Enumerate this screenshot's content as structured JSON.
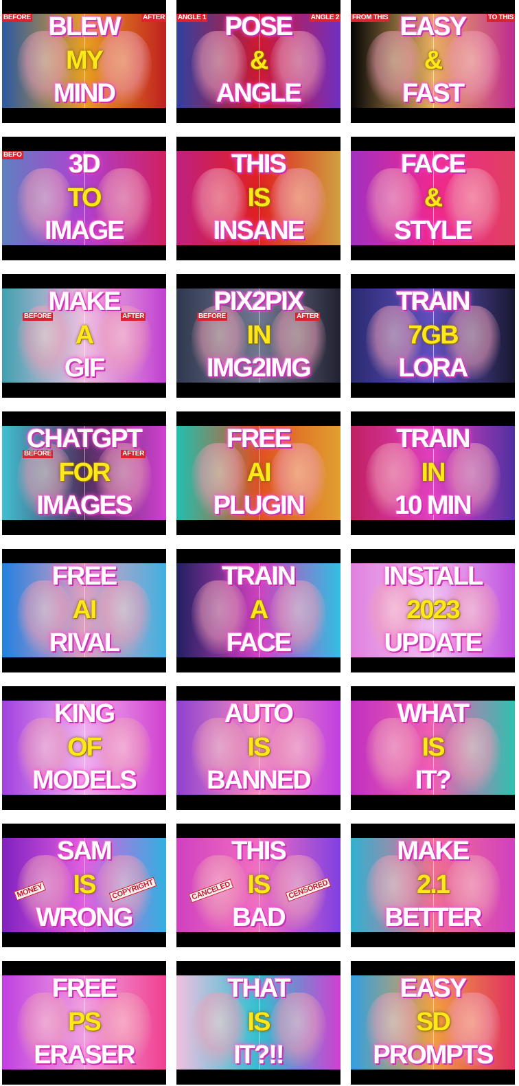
{
  "thumbnails": [
    {
      "lines": [
        "BLEW",
        "MY",
        "MIND"
      ],
      "tags": [
        {
          "text": "BEFORE",
          "side": "left",
          "row": "top"
        },
        {
          "text": "AFTER",
          "side": "right",
          "row": "top"
        }
      ],
      "colors": [
        "#2a5aa0",
        "#e8a020",
        "#c02020"
      ]
    },
    {
      "lines": [
        "POSE",
        "&",
        "ANGLE"
      ],
      "tags": [
        {
          "text": "ANGLE 1",
          "side": "left",
          "row": "top"
        },
        {
          "text": "ANGLE 2",
          "side": "right",
          "row": "top"
        }
      ],
      "colors": [
        "#3040a0",
        "#d01830",
        "#7030c0"
      ]
    },
    {
      "lines": [
        "EASY",
        "&",
        "FAST"
      ],
      "tags": [
        {
          "text": "FROM THIS",
          "side": "left",
          "row": "top"
        },
        {
          "text": "TO THIS",
          "side": "right",
          "row": "top"
        }
      ],
      "colors": [
        "#050505",
        "#e8b060",
        "#c02a90"
      ]
    },
    {
      "lines": [
        "3D",
        "TO",
        "IMAGE"
      ],
      "tags": [
        {
          "text": "BEFO",
          "side": "left",
          "row": "top"
        }
      ],
      "colors": [
        "#6080c0",
        "#b040d0",
        "#d02060"
      ]
    },
    {
      "lines": [
        "THIS",
        "IS",
        "INSANE"
      ],
      "tags": [],
      "colors": [
        "#c02080",
        "#e02020",
        "#d0a040"
      ]
    },
    {
      "lines": [
        "FACE",
        "&",
        "STYLE"
      ],
      "tags": [],
      "colors": [
        "#a030c0",
        "#f02890",
        "#e04060"
      ]
    },
    {
      "lines": [
        "MAKE",
        "A",
        "GIF"
      ],
      "tags": [
        {
          "text": "BEFORE",
          "side": "left",
          "row": "middle"
        },
        {
          "text": "AFTER",
          "side": "right",
          "row": "middle"
        }
      ],
      "colors": [
        "#40a0b0",
        "#f0c0e0",
        "#c040d0"
      ]
    },
    {
      "lines": [
        "PIX2PIX",
        "IN",
        "IMG2IMG"
      ],
      "tags": [
        {
          "text": "BEFORE",
          "side": "left",
          "row": "middle"
        },
        {
          "text": "AFTER",
          "side": "right",
          "row": "middle"
        }
      ],
      "colors": [
        "#303850",
        "#707890",
        "#202030"
      ]
    },
    {
      "lines": [
        "TRAIN",
        "7GB",
        "LORA"
      ],
      "tags": [],
      "colors": [
        "#2a2a70",
        "#6050c0",
        "#181830"
      ]
    },
    {
      "lines": [
        "CHATGPT",
        "FOR",
        "IMAGES"
      ],
      "tags": [
        {
          "text": "BEFORE",
          "side": "left",
          "row": "middle"
        },
        {
          "text": "AFTER",
          "side": "right",
          "row": "middle"
        }
      ],
      "colors": [
        "#40c0d0",
        "#503060",
        "#d040d0"
      ]
    },
    {
      "lines": [
        "FREE",
        "AI",
        "PLUGIN"
      ],
      "tags": [],
      "colors": [
        "#20c0b0",
        "#e05020",
        "#e0a030"
      ]
    },
    {
      "lines": [
        "TRAIN",
        "IN",
        "10 MIN"
      ],
      "tags": [],
      "colors": [
        "#c02060",
        "#e040c0",
        "#5030a0"
      ]
    },
    {
      "lines": [
        "FREE",
        "AI",
        "RIVAL"
      ],
      "tags": [],
      "colors": [
        "#2080e0",
        "#e0a0c0",
        "#40b0e0"
      ]
    },
    {
      "lines": [
        "TRAIN",
        "A",
        "FACE"
      ],
      "tags": [],
      "colors": [
        "#202060",
        "#d040c0",
        "#30c0e0"
      ]
    },
    {
      "lines": [
        "INSTALL",
        "2023",
        "UPDATE"
      ],
      "tags": [],
      "colors": [
        "#e080e0",
        "#f0c0f0",
        "#c050e0"
      ]
    },
    {
      "lines": [
        "KING",
        "OF",
        "MODELS"
      ],
      "tags": [],
      "colors": [
        "#a040e0",
        "#f0b0f0",
        "#d040d0"
      ]
    },
    {
      "lines": [
        "AUTO",
        "IS",
        "BANNED"
      ],
      "tags": [],
      "colors": [
        "#9040d0",
        "#f090c0",
        "#c040e0"
      ]
    },
    {
      "lines": [
        "WHAT",
        "IS",
        "IT?"
      ],
      "tags": [],
      "colors": [
        "#c030c0",
        "#f060b0",
        "#30c0b0"
      ]
    },
    {
      "lines": [
        "SAM",
        "IS",
        "WRONG"
      ],
      "tags": [
        {
          "text": "MONEY",
          "side": "left",
          "row": "tape"
        },
        {
          "text": "COPYRIGHT",
          "side": "right",
          "row": "tape"
        }
      ],
      "colors": [
        "#8020c0",
        "#e060e0",
        "#30b0e0"
      ]
    },
    {
      "lines": [
        "THIS",
        "IS",
        "BAD"
      ],
      "tags": [
        {
          "text": "CANCELED",
          "side": "left",
          "row": "tape"
        },
        {
          "text": "CENSORED",
          "side": "right",
          "row": "tape"
        }
      ],
      "colors": [
        "#d040c0",
        "#f070c0",
        "#8040e0"
      ]
    },
    {
      "lines": [
        "MAKE",
        "2.1",
        "BETTER"
      ],
      "tags": [],
      "colors": [
        "#30b0d0",
        "#f07090",
        "#d040c0"
      ]
    },
    {
      "lines": [
        "FREE",
        "PS",
        "ERASER"
      ],
      "tags": [],
      "colors": [
        "#c040e0",
        "#f0a0e0",
        "#f04090"
      ]
    },
    {
      "lines": [
        "THAT",
        "IS",
        "IT?!!"
      ],
      "tags": [],
      "colors": [
        "#f0c0e0",
        "#30c0d0",
        "#d040d0"
      ]
    },
    {
      "lines": [
        "EASY",
        "SD",
        "PROMPTS"
      ],
      "tags": [],
      "colors": [
        "#30a0e0",
        "#f0a040",
        "#e03060"
      ]
    }
  ]
}
